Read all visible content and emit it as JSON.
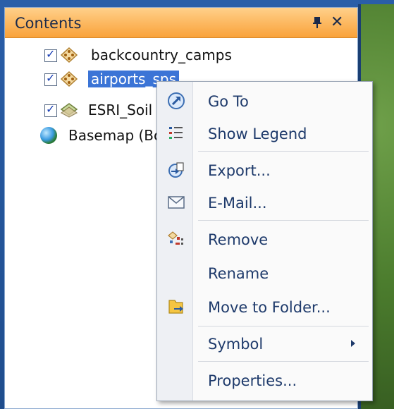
{
  "panel": {
    "title": "Contents"
  },
  "layers": [
    {
      "label": "backcountry_camps",
      "checked": true,
      "icon": "point-layer-icon"
    },
    {
      "label": "airports_sps",
      "checked": true,
      "icon": "point-layer-icon",
      "selected": true
    },
    {
      "label": "ESRI_Soil",
      "checked": true,
      "icon": "polygon-layer-icon"
    },
    {
      "label": "Basemap (Bc",
      "icon": "globe-icon"
    }
  ],
  "context_menu": {
    "items": [
      {
        "label": "Go To",
        "icon": "zoom-to-icon"
      },
      {
        "label": "Show Legend",
        "icon": "legend-icon"
      },
      {
        "label": "Export...",
        "icon": "export-icon"
      },
      {
        "label": "E-Mail...",
        "icon": "email-icon"
      },
      {
        "label": "Remove",
        "icon": "remove-icon"
      },
      {
        "label": "Rename",
        "icon": ""
      },
      {
        "label": "Move to Folder...",
        "icon": "folder-icon"
      },
      {
        "label": "Symbol",
        "icon": "",
        "submenu": true
      },
      {
        "label": "Properties...",
        "icon": ""
      }
    ]
  },
  "colors": {
    "header": "#f9a23a",
    "selection": "#3b74d6",
    "menu_text": "#1e3a6b"
  }
}
